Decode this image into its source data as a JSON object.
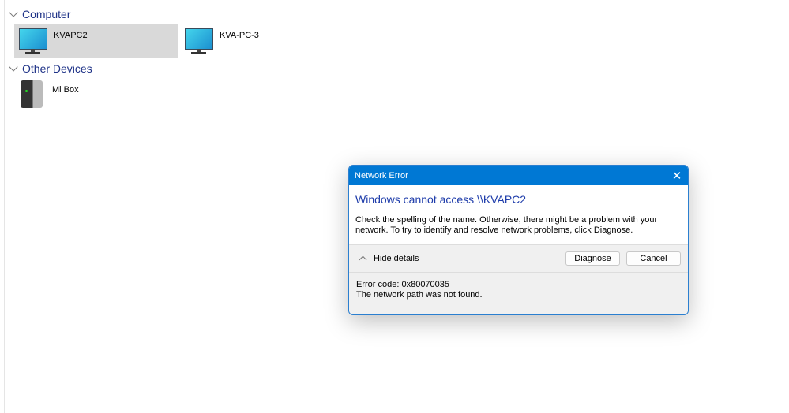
{
  "explorer": {
    "groups": [
      {
        "label": "Computer",
        "items": [
          {
            "label": "KVAPC2"
          },
          {
            "label": "KVA-PC-3"
          }
        ]
      },
      {
        "label": "Other Devices",
        "items": [
          {
            "label": "Mi Box"
          }
        ]
      }
    ]
  },
  "dialog": {
    "title": "Network Error",
    "close_glyph": "✕",
    "heading": "Windows cannot access \\\\KVAPC2",
    "message": "Check the spelling of the name. Otherwise, there might be a problem with your network. To try to identify and resolve network problems, click Diagnose.",
    "hide_details": "Hide details",
    "diagnose": "Diagnose",
    "cancel": "Cancel",
    "error_code": "Error code: 0x80070035",
    "error_text": "The network path was not found."
  },
  "colors": {
    "accent": "#0078d4",
    "heading": "#1e3caa"
  }
}
